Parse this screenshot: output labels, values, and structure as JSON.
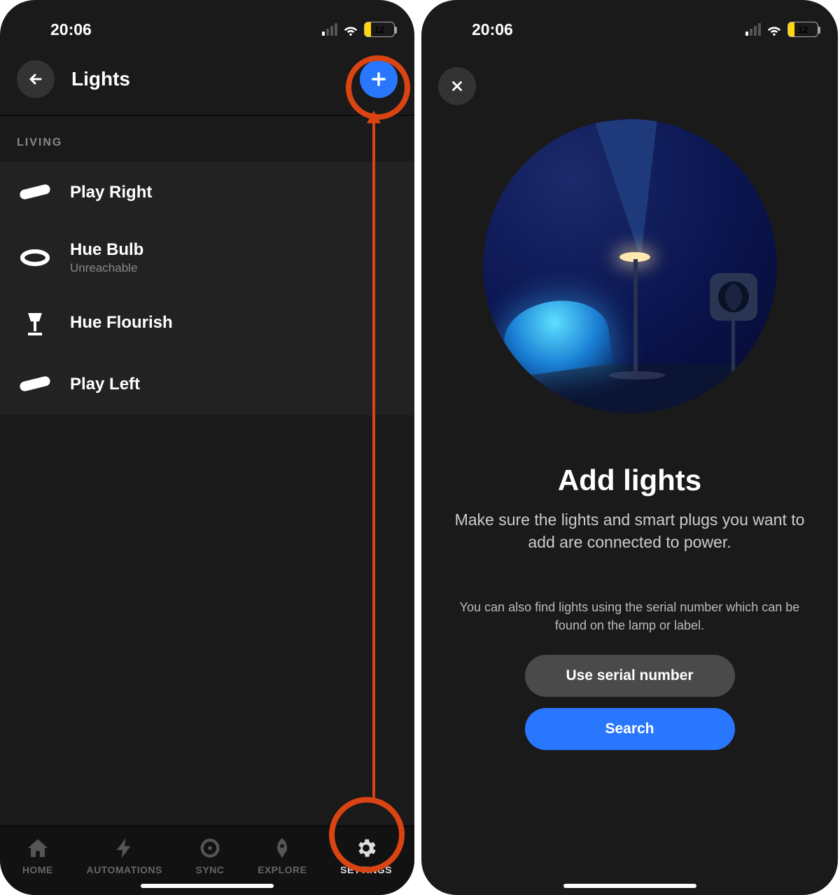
{
  "status": {
    "time": "20:06",
    "battery": "12"
  },
  "left": {
    "title": "Lights",
    "section": "LIVING",
    "items": [
      {
        "name": "Play Right",
        "sub": "",
        "icon": "playbar"
      },
      {
        "name": "Hue Bulb",
        "sub": "Unreachable",
        "icon": "bulb"
      },
      {
        "name": "Hue Flourish",
        "sub": "",
        "icon": "tablelamp"
      },
      {
        "name": "Play Left",
        "sub": "",
        "icon": "playbar"
      }
    ],
    "tabs": [
      {
        "label": "HOME"
      },
      {
        "label": "AUTOMATIONS"
      },
      {
        "label": "SYNC"
      },
      {
        "label": "EXPLORE"
      },
      {
        "label": "SETTINGS"
      }
    ]
  },
  "right": {
    "title": "Add lights",
    "subtitle": "Make sure the lights and smart plugs you want to add are connected to power.",
    "hint": "You can also find lights using the serial number which can be found on the lamp or label.",
    "serial_btn": "Use serial number",
    "search_btn": "Search"
  },
  "annotation": {
    "highlight_color": "#d94412",
    "targets": [
      "add-light-button",
      "tab-settings"
    ]
  }
}
